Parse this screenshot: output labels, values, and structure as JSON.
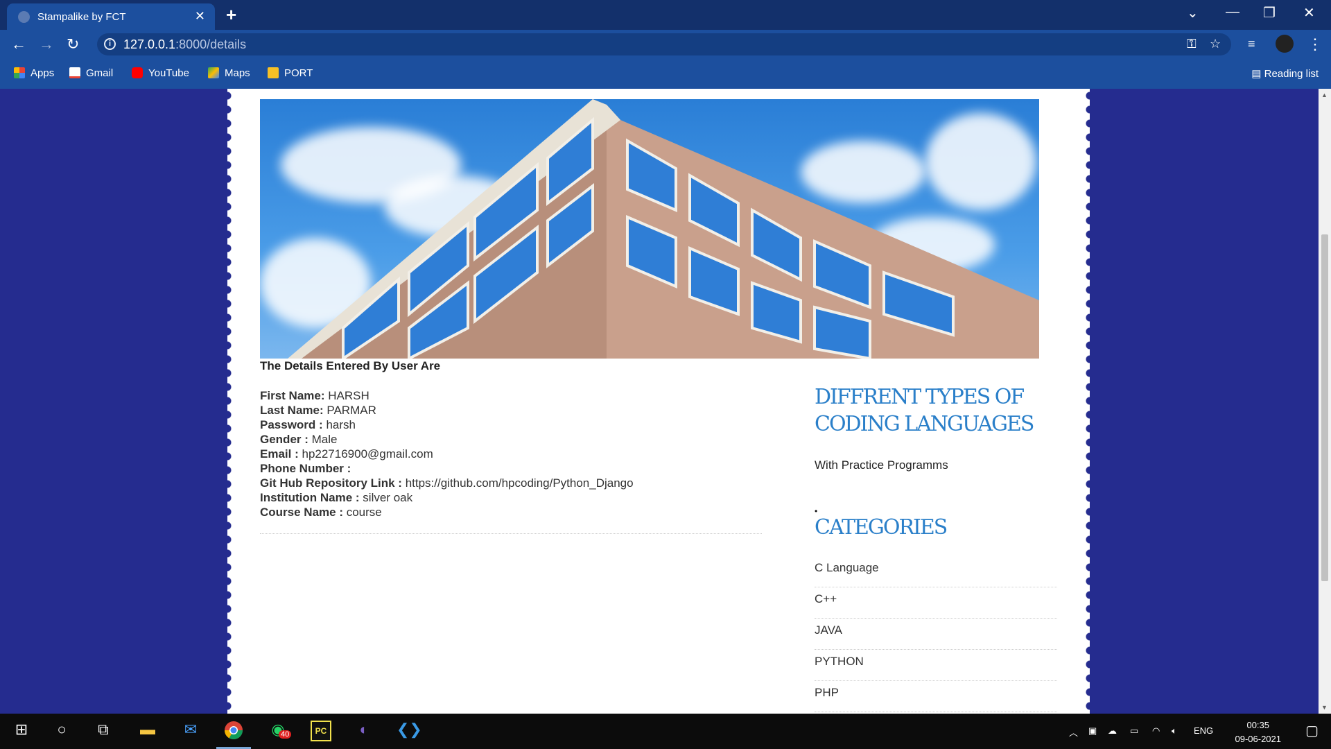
{
  "browser": {
    "tab_title": "Stampalike by FCT",
    "url_host": "127.0.0.1",
    "url_path": ":8000/details",
    "bookmarks": [
      {
        "label": "Apps",
        "color": "#e94235"
      },
      {
        "label": "Gmail",
        "color": "#ea4335"
      },
      {
        "label": "YouTube",
        "color": "#ff0000"
      },
      {
        "label": "Maps",
        "color": "#34a853"
      },
      {
        "label": "PORT",
        "color": "#f6c026"
      }
    ],
    "reading_list": "Reading list"
  },
  "details": {
    "heading": "The Details Entered By User Are",
    "fields": [
      {
        "label": "First Name:",
        "value": "HARSH"
      },
      {
        "label": "Last Name:",
        "value": "PARMAR"
      },
      {
        "label": "Password :",
        "value": "harsh"
      },
      {
        "label": "Gender :",
        "value": "Male"
      },
      {
        "label": "Email :",
        "value": "hp22716900@gmail.com"
      },
      {
        "label": "Phone Number :",
        "value": ""
      },
      {
        "label": "Git Hub Repository Link :",
        "value": "https://github.com/hpcoding/Python_Django"
      },
      {
        "label": "Institution Name :",
        "value": "silver oak"
      },
      {
        "label": "Course Name :",
        "value": "course"
      }
    ]
  },
  "sidebar": {
    "title_line1": "DIFFRENT TYPES OF",
    "title_line2": "CODING LANGUAGES",
    "subtitle": "With Practice Programms",
    "bullet": "•",
    "categories_title": "CATEGORIES",
    "categories": [
      "C Language",
      "C++",
      "JAVA",
      "PYTHON",
      "PHP"
    ]
  },
  "taskbar": {
    "whatsapp_badge": "40",
    "language": "ENG",
    "time": "00:35",
    "date": "09-06-2021"
  },
  "colors": {
    "page_bg": "#252c8f",
    "accent_title": "#2a7fc9",
    "chrome": "#1c4f9e"
  }
}
